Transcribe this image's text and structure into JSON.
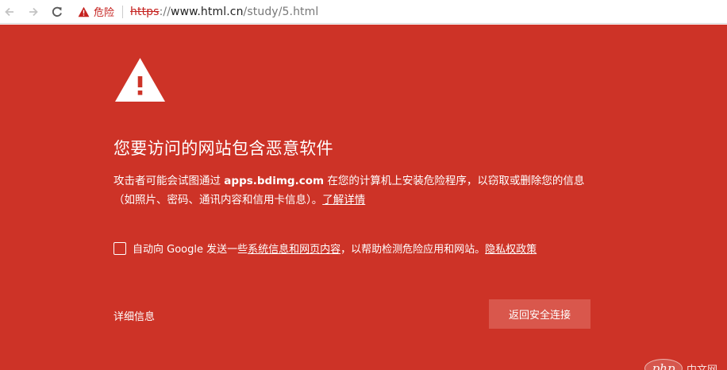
{
  "browser": {
    "security_label": "危险",
    "url": {
      "scheme": "https",
      "separator": "://",
      "host": "www.html.cn",
      "path": "/study/5.html"
    }
  },
  "interstitial": {
    "title": "您要访问的网站包含恶意软件",
    "body": {
      "part1": "攻击者可能会试图通过 ",
      "domain": "apps.bdimg.com",
      "part2": " 在您的计算机上安装危险程序，以窃取或删除您的信息（如照片、密码、通讯内容和信用卡信息）。",
      "learn_more": "了解详情"
    },
    "opt_in": {
      "prefix": "自动向 Google 发送一些",
      "link1": "系统信息和网页内容",
      "middle": "，以帮助检测危险应用和网站。",
      "link2": "隐私权政策"
    },
    "details_label": "详细信息",
    "back_button_label": "返回安全连接"
  },
  "watermark": {
    "logo_text": "php",
    "site_text": "中文网"
  },
  "colors": {
    "background": "#cd3327",
    "button": "#d9574c",
    "danger_text": "#c5221f"
  }
}
